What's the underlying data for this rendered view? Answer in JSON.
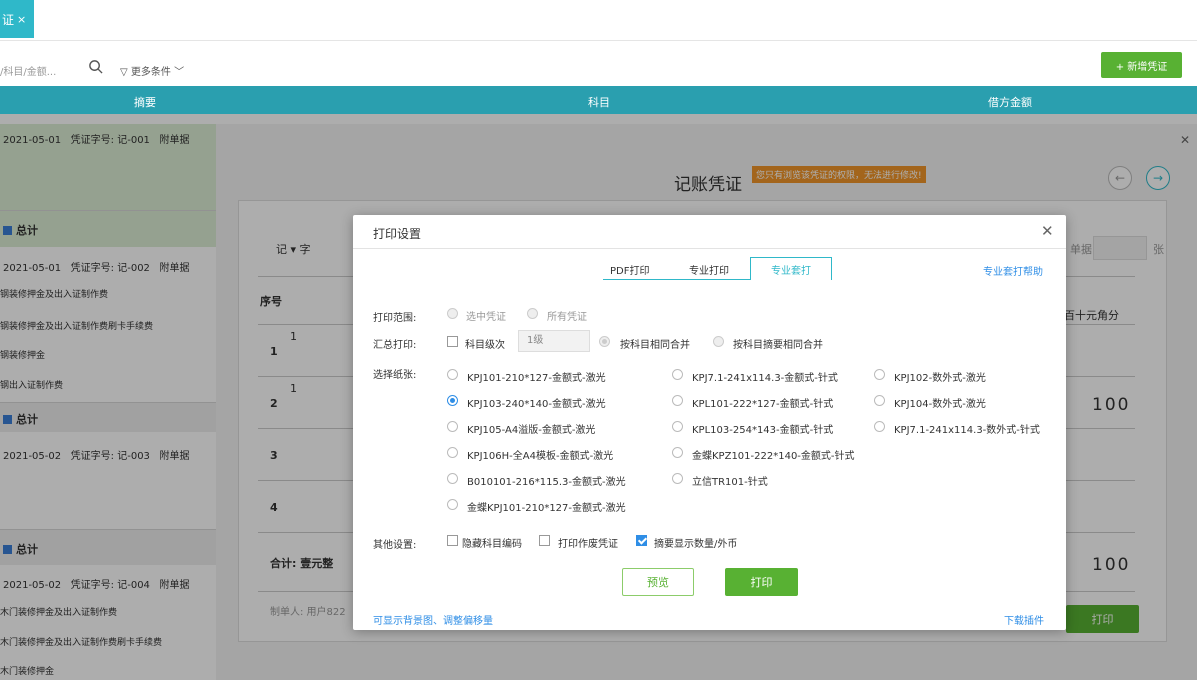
{
  "topbar": {
    "tab_label": "证",
    "tab_close": "×"
  },
  "toolbar": {
    "search_placeholder": "/科目/金额...",
    "filter_label": "更多条件",
    "add_button": "+ 新增凭证"
  },
  "table_header": {
    "col1": "摘要",
    "col2": "科目",
    "col3": "借方金额"
  },
  "voucher_list": [
    {
      "date": "2021-05-01",
      "no_label": "凭证字号: 记-001",
      "attach": "附单据"
    },
    {
      "date": "2021-05-01",
      "no_label": "凭证字号: 记-002",
      "attach": "附单据"
    },
    {
      "date": "2021-05-02",
      "no_label": "凭证字号: 记-003",
      "attach": "附单据"
    },
    {
      "date": "2021-05-02",
      "no_label": "凭证字号: 记-004",
      "attach": "附单据"
    }
  ],
  "total_label": "总计",
  "list_lines": {
    "l1": "钢装修押金及出入证制作费",
    "l2": "钢装修押金及出入证制作费刷卡手续费",
    "l3": "钢装修押金",
    "l4": "钢出入证制作费",
    "l5": "木门装修押金及出入证制作费",
    "l6": "木门装修押金及出入证制作费刷卡手续费",
    "l7": "木门装修押金"
  },
  "voucher_panel": {
    "title": "记账凭证",
    "warning": "您只有浏览该凭证的权限，无法进行修改!",
    "word_label": "记",
    "word_suffix": "字",
    "seq_header": "序号",
    "rows": [
      "1",
      "2",
      "3",
      "4"
    ],
    "row_marks": [
      "1",
      "1"
    ],
    "total_row": "合计: 壹元整",
    "amount": "100",
    "amount2": "100",
    "digits_header": "百十元角分",
    "attach_unit": "张",
    "attach_label": "单据",
    "creator": "制单人: 用户822",
    "print_btn": "打印"
  },
  "modal": {
    "title": "打印设置",
    "tabs": [
      "PDF打印",
      "专业打印",
      "专业套打"
    ],
    "help_link": "专业套打帮助",
    "print_range_label": "打印范围:",
    "range_options": [
      "选中凭证",
      "所有凭证"
    ],
    "summary_label": "汇总打印:",
    "subject_level_label": "科目级次",
    "subject_level_value": "1级",
    "merge_options": [
      "按科目相同合并",
      "按科目摘要相同合并"
    ],
    "paper_label": "选择纸张:",
    "paper_col1": [
      "KPJ101-210*127-金额式-激光",
      "KPJ103-240*140-金额式-激光",
      "KPJ105-A4溢版-金额式-激光",
      "KPJ106H-全A4模板-金额式-激光",
      "B010101-216*115.3-金额式-激光",
      "金蝶KPJ101-210*127-金额式-激光"
    ],
    "paper_col2": [
      "KPJ7.1-241x114.3-金额式-针式",
      "KPL101-222*127-金额式-针式",
      "KPL103-254*143-金额式-针式",
      "金蝶KPZ101-222*140-金额式-针式",
      "立信TR101-针式"
    ],
    "paper_col3": [
      "KPJ102-数外式-激光",
      "KPJ104-数外式-激光",
      "KPJ7.1-241x114.3-数外式-针式"
    ],
    "selected_paper": "KPJ103-240*140-金额式-激光",
    "other_label": "其他设置:",
    "other_options": [
      "隐藏科目编码",
      "打印作废凭证",
      "摘要显示数量/外币"
    ],
    "preview_button": "预览",
    "print_button": "打印",
    "footer_left": "可显示背景图、调整偏移量",
    "footer_right": "下载插件"
  },
  "colors": {
    "accent": "#2fb8c9",
    "header": "#2a9faf",
    "green": "#58b133",
    "link": "#2f8ee6",
    "warning": "#f0962a"
  }
}
